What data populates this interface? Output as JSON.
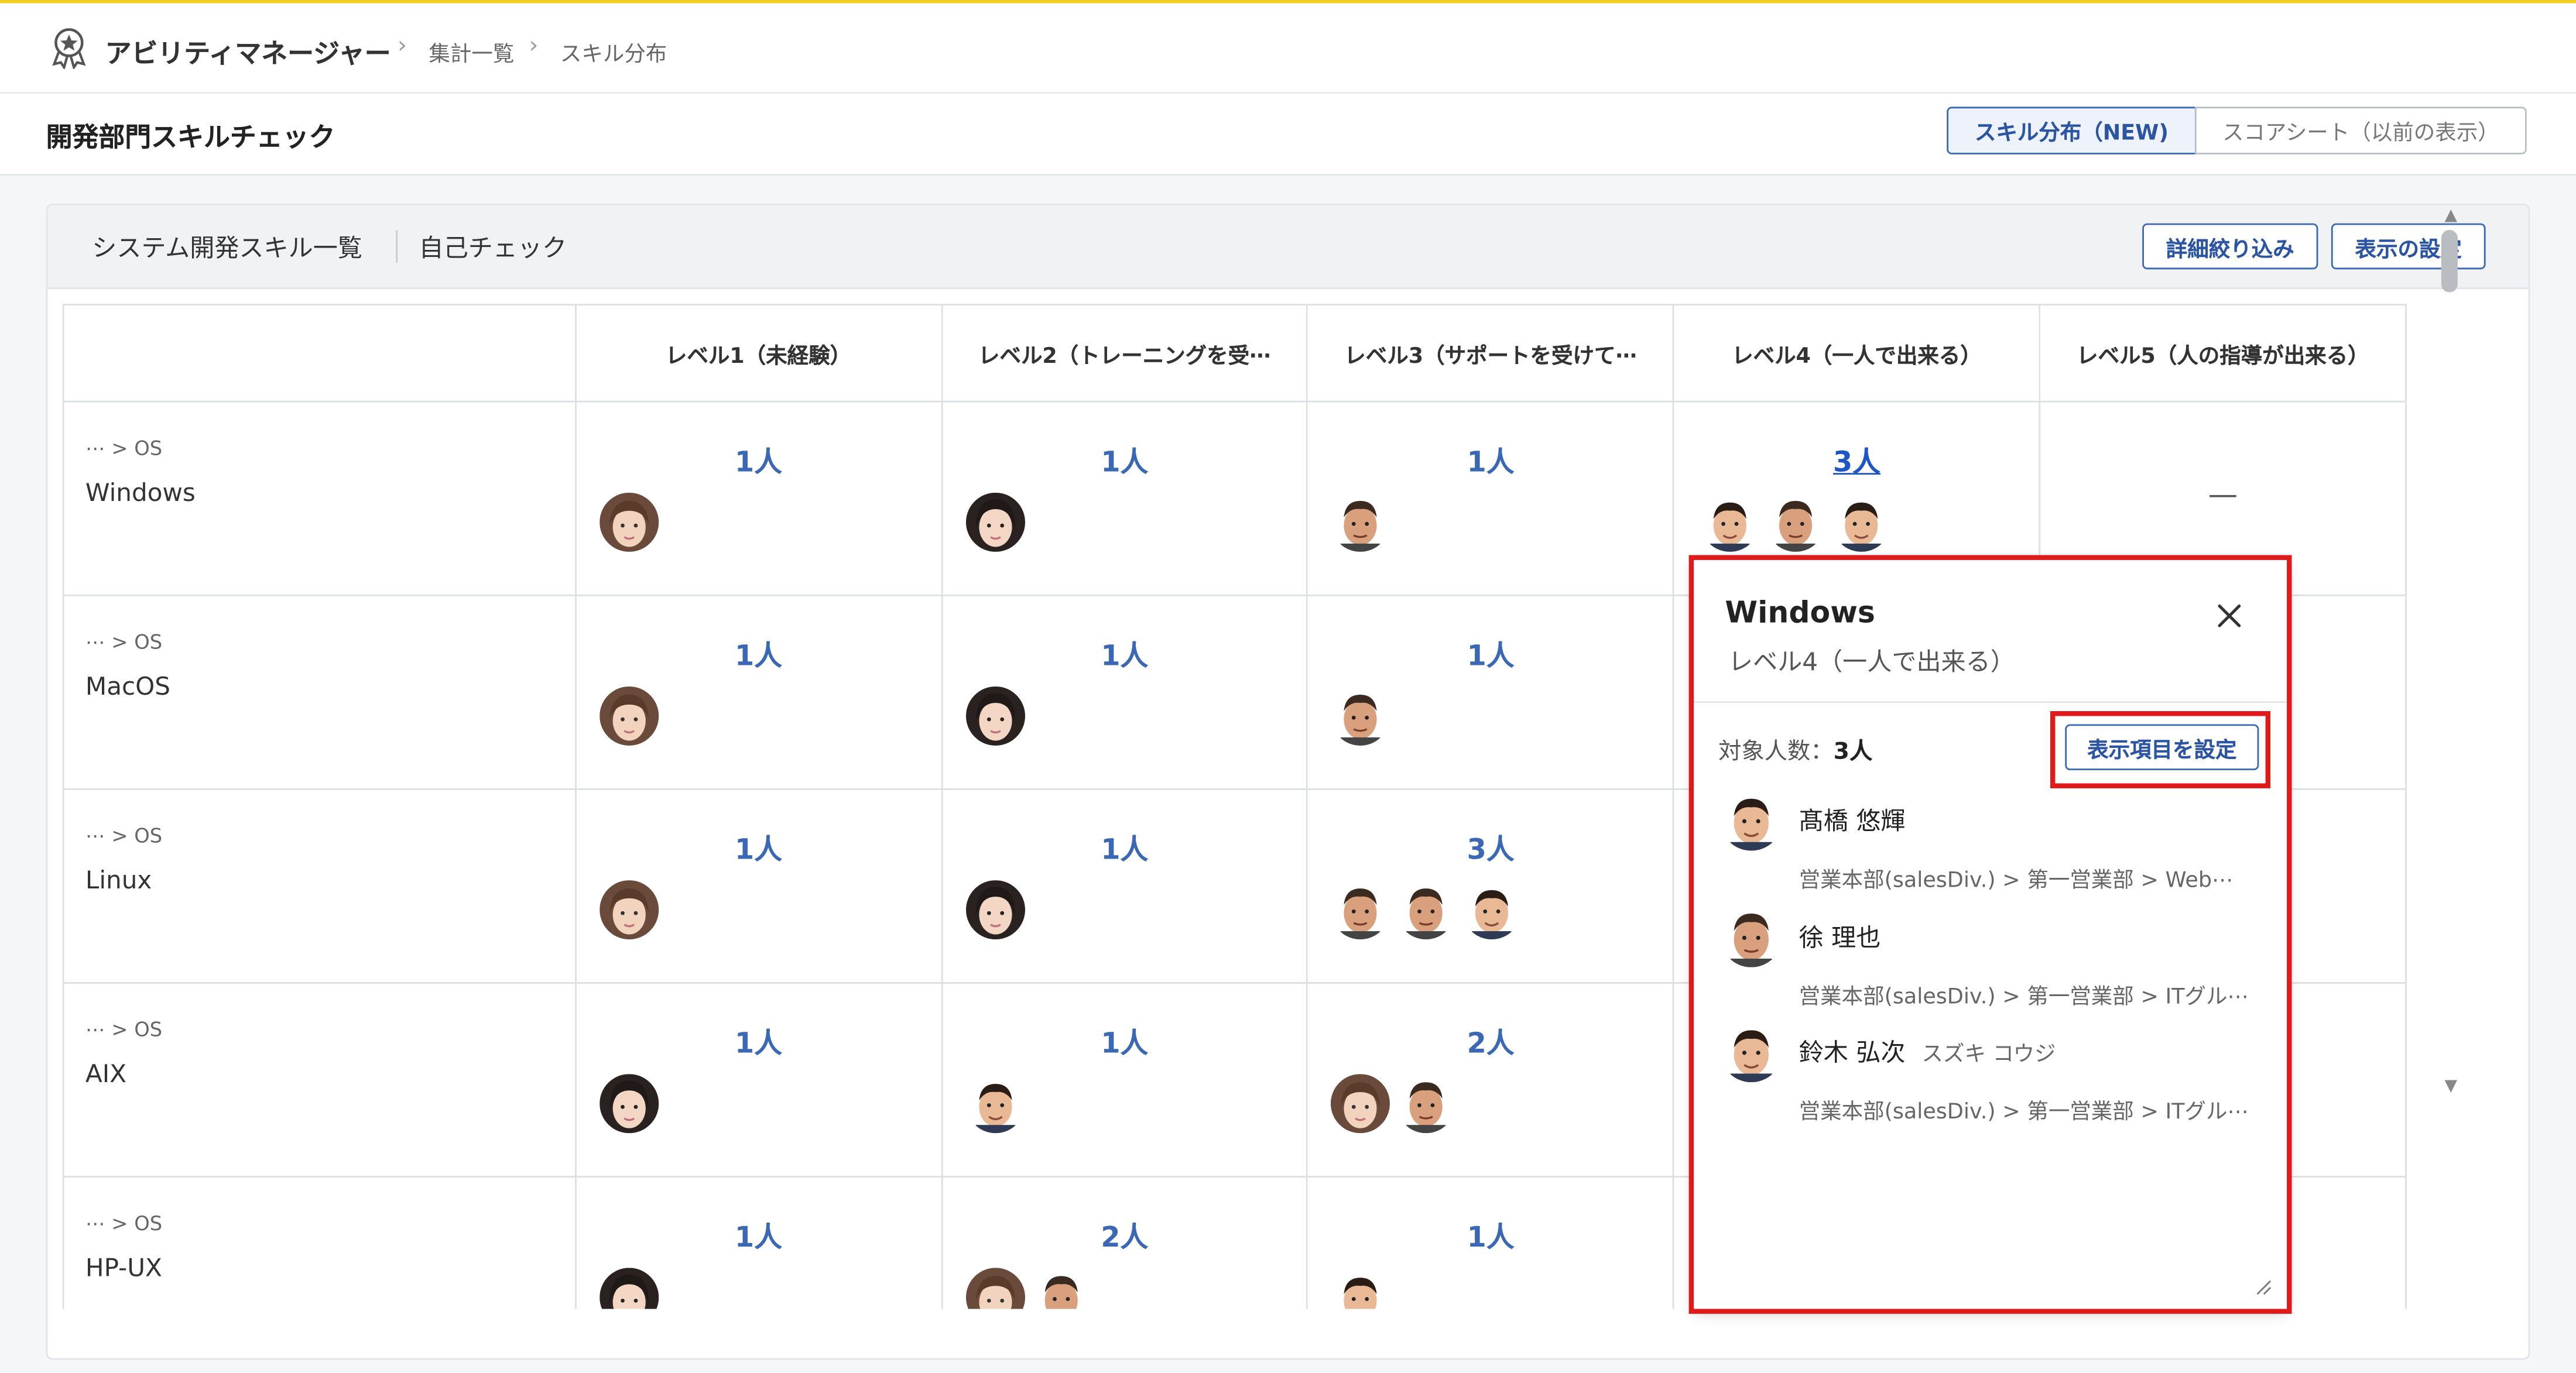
{
  "colors": {
    "accent": "#3b68b5",
    "link": "#1e56c6",
    "highlight": "#e01a1a",
    "topline": "#f2cd1f"
  },
  "header": {
    "logo_icon": "award-ribbon-icon",
    "app_title": "アビリティマネージャー",
    "breadcrumbs": [
      "集計一覧",
      "スキル分布"
    ]
  },
  "subheader": {
    "title": "開発部門スキルチェック",
    "view_buttons": [
      {
        "label": "スキル分布（NEW)",
        "active": true
      },
      {
        "label": "スコアシート（以前の表示）",
        "active": false
      }
    ]
  },
  "panel": {
    "tab_title": "システム開発スキル一覧",
    "tab_sub": "自己チェック",
    "filter_button": "詳細絞り込み",
    "settings_button": "表示の設定"
  },
  "table": {
    "columns": [
      "レベル1（未経験）",
      "レベル2（トレーニングを受⋯",
      "レベル3（サポートを受けて⋯",
      "レベル4（一人で出来る）",
      "レベル5（人の指導が出来る）"
    ],
    "rows": [
      {
        "path": "⋯ > OS",
        "skill": "Windows",
        "counts": [
          "1人",
          "1人",
          "1人",
          "3人",
          "—"
        ]
      },
      {
        "path": "⋯ > OS",
        "skill": "MacOS",
        "counts": [
          "1人",
          "1人",
          "1人",
          "",
          ""
        ]
      },
      {
        "path": "⋯ > OS",
        "skill": "Linux",
        "counts": [
          "1人",
          "1人",
          "3人",
          "",
          ""
        ]
      },
      {
        "path": "⋯ > OS",
        "skill": "AIX",
        "counts": [
          "1人",
          "1人",
          "2人",
          "",
          ""
        ]
      },
      {
        "path": "⋯ > OS",
        "skill": "HP-UX",
        "counts": [
          "1人",
          "2人",
          "1人",
          "",
          ""
        ]
      }
    ]
  },
  "popup": {
    "title": "Windows",
    "subtitle": "レベル4（一人で出来る）",
    "close_icon": "close-icon",
    "count_label": "対象人数：",
    "count_value": "3人",
    "settings_button": "表示項目を設定",
    "members": [
      {
        "name": "髙橋 悠輝",
        "kana": "",
        "org": "営業本部(salesDiv.) > 第一営業部 > Web⋯"
      },
      {
        "name": "徐 理也",
        "kana": "",
        "org": "営業本部(salesDiv.) > 第一営業部 > ITグル⋯"
      },
      {
        "name": "鈴木 弘次",
        "kana": "スズキ コウジ",
        "org": "営業本部(salesDiv.) > 第一営業部 > ITグル⋯"
      }
    ]
  }
}
